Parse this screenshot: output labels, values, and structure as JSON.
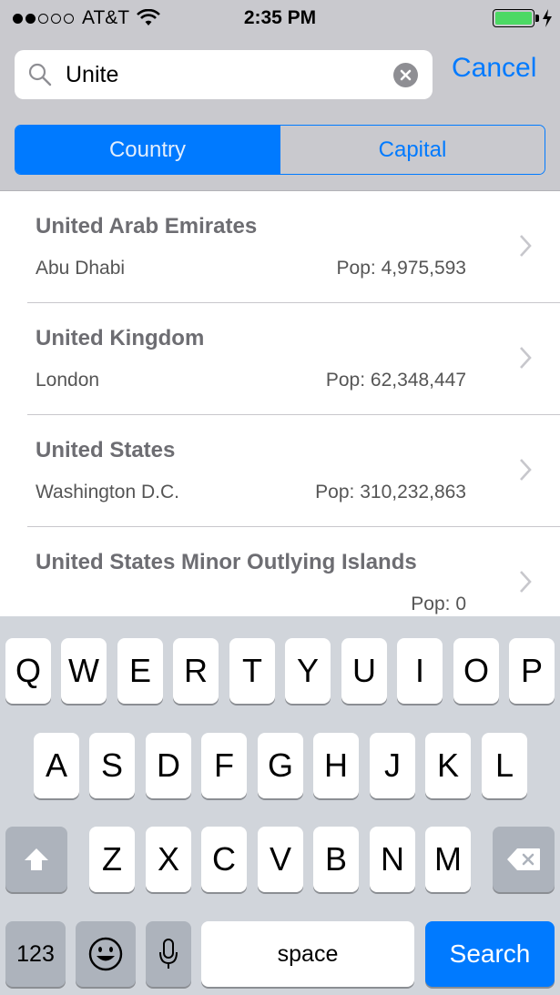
{
  "status_bar": {
    "carrier": "AT&T",
    "time": "2:35 PM"
  },
  "search": {
    "value": "Unite",
    "cancel_label": "Cancel"
  },
  "segments": {
    "country": "Country",
    "capital": "Capital",
    "selected": "Country"
  },
  "results": [
    {
      "name": "United Arab Emirates",
      "capital": "Abu Dhabi",
      "population": "Pop: 4,975,593"
    },
    {
      "name": "United Kingdom",
      "capital": "London",
      "population": "Pop: 62,348,447"
    },
    {
      "name": "United States",
      "capital": "Washington D.C.",
      "population": "Pop: 310,232,863"
    },
    {
      "name": "United States Minor Outlying Islands",
      "capital": "",
      "population": "Pop: 0"
    }
  ],
  "keyboard": {
    "row1": [
      "Q",
      "W",
      "E",
      "R",
      "T",
      "Y",
      "U",
      "I",
      "O",
      "P"
    ],
    "row2": [
      "A",
      "S",
      "D",
      "F",
      "G",
      "H",
      "J",
      "K",
      "L"
    ],
    "row3": [
      "Z",
      "X",
      "C",
      "V",
      "B",
      "N",
      "M"
    ],
    "numbers_label": "123",
    "space_label": "space",
    "search_label": "Search"
  },
  "colors": {
    "accent": "#007aff",
    "battery": "#4cd964"
  }
}
